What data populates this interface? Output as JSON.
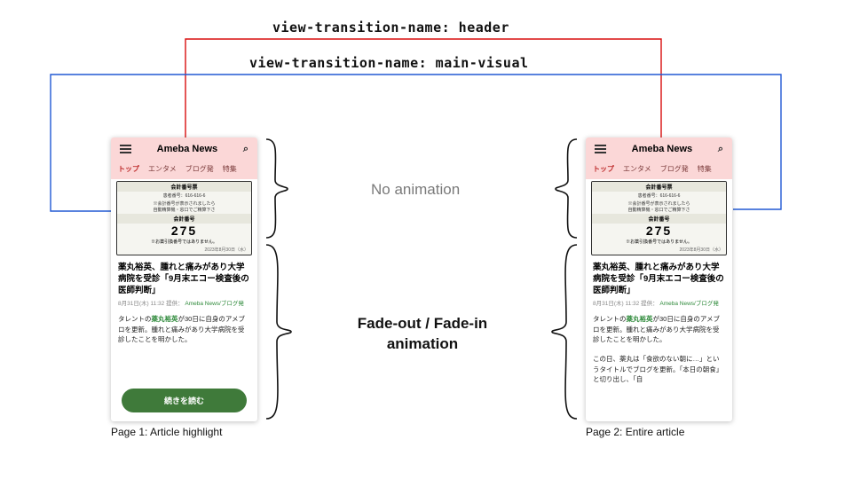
{
  "codeLabels": {
    "header": "view-transition-name: header",
    "mainVisual": "view-transition-name: main-visual"
  },
  "annotations": {
    "noAnimation": "No animation",
    "fadeLine1": "Fade-out / Fade-in",
    "fadeLine2": "animation"
  },
  "captions": {
    "p1": "Page 1: Article highlight",
    "p2": "Page 2: Entire article"
  },
  "phone": {
    "siteTitle": "Ameba News",
    "searchGlyph": "⌕",
    "nav": [
      "トップ",
      "エンタメ",
      "ブログ発",
      "特集"
    ],
    "ticket": {
      "t1": "会計番号票",
      "t2": "患者番号：616-616-6",
      "t3": "※会計番号が表示されましたら\n自動精算機・窓口でご精算下さ",
      "t4": "会計番号",
      "t5": "275",
      "t6": "※お薬引換番号ではありません。",
      "t7": "2023年8月30日（水）"
    },
    "headline": "薬丸裕英、腫れと痛みがあり大学病院を受診「9月末エコー検査後の医師判断」",
    "metaTime": "8月31日(木) 11:32  提供：",
    "metaSource": "Ameba News/ブログ発",
    "bodyPrefix": "タレントの",
    "bodyLink": "薬丸裕英",
    "bodyRest": "が30日に自身のアメブロを更新。腫れと痛みがあり大学病院を受診したことを明かした。",
    "cta": "続きを読む",
    "bodyExtra": "この日、薬丸は「食欲のない朝に…」というタイトルでブログを更新。「本日の朝食」と切り出し、「自"
  },
  "connectors": {
    "red": "#d90e0e",
    "blue": "#2059d4"
  }
}
